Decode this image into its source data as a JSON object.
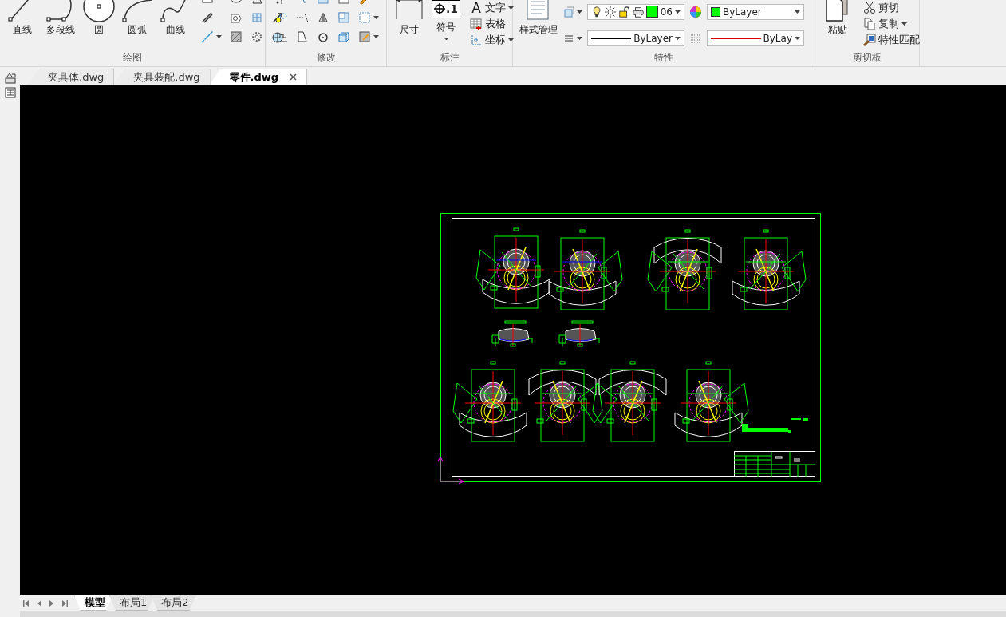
{
  "ribbon": {
    "panels": [
      {
        "kind": "draw",
        "title": "绘图",
        "tools": [
          {
            "label": "直线"
          },
          {
            "label": "多段线"
          },
          {
            "label": "圆"
          },
          {
            "label": "圆弧"
          },
          {
            "label": "曲线"
          }
        ]
      },
      {
        "kind": "modify",
        "title": "修改"
      },
      {
        "kind": "annotate",
        "title": "标注",
        "tools": [
          {
            "label": "尺寸"
          },
          {
            "label": "符号",
            "icon_text": ".1"
          }
        ],
        "small_tools": [
          {
            "label": "文字",
            "icon_text": "A"
          },
          {
            "label": "表格"
          },
          {
            "label": "坐标"
          }
        ]
      },
      {
        "kind": "properties",
        "title": "特性",
        "tools": [
          {
            "label": "样式管理"
          }
        ],
        "layer": {
          "value": "06",
          "color": "#00ff00"
        },
        "color_combo": {
          "value": "ByLayer",
          "color": "#00ff00"
        },
        "linetype": {
          "value": "ByLayer"
        },
        "lineweight": {
          "value": "ByLay"
        }
      },
      {
        "kind": "clipboard",
        "title": "剪切板",
        "tools": [
          {
            "label": "粘贴"
          }
        ],
        "small_tools": [
          {
            "label": "剪切"
          },
          {
            "label": "复制"
          },
          {
            "label": "特性匹配"
          }
        ]
      }
    ]
  },
  "file_tabs": [
    {
      "label": "夹具体.dwg",
      "selected": false,
      "closable": false
    },
    {
      "label": "夹具装配.dwg",
      "selected": false,
      "closable": false
    },
    {
      "label": "零件.dwg",
      "selected": true,
      "closable": true
    }
  ],
  "layout_tabs": [
    {
      "label": "模型",
      "selected": true
    },
    {
      "label": "布局1",
      "selected": false
    },
    {
      "label": "布局2",
      "selected": false
    }
  ]
}
